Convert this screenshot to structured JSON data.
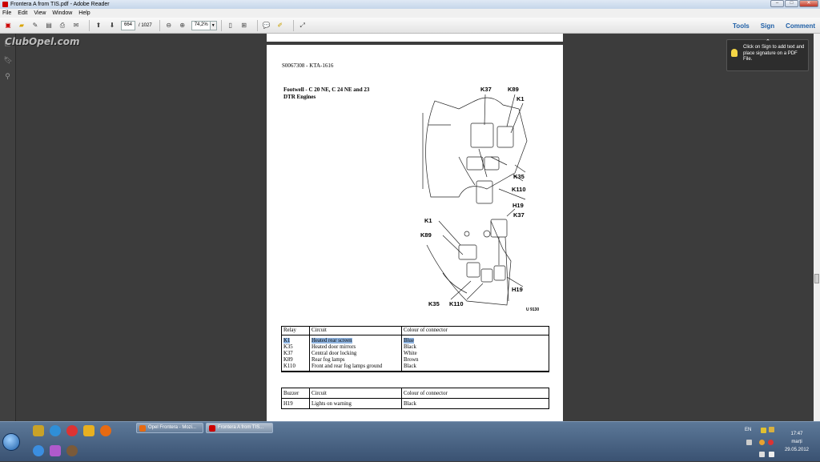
{
  "window": {
    "title": "Frontera A from TIS.pdf - Adobe Reader",
    "buttons": [
      "–",
      "□",
      "✕"
    ]
  },
  "menu": [
    "File",
    "Edit",
    "View",
    "Window",
    "Help"
  ],
  "toolbar": {
    "page_current": "664",
    "page_total": "/ 1027",
    "zoom": "74,2%",
    "right_links": [
      "Tools",
      "Sign",
      "Comment"
    ]
  },
  "watermark": "ClubOpel.com",
  "tooltip": {
    "text": "Click on Sign to add text and place signature on a PDF File."
  },
  "document": {
    "doc_id": "S0067308  -  KTA-1616",
    "heading": "Footwell - C 20 NE, C 24 NE and 23 DTR Engines",
    "diagram_labels": {
      "top": [
        "K37",
        "K89",
        "K1",
        "K35",
        "K110",
        "H19"
      ],
      "bottom": [
        "K1",
        "K89",
        "K37",
        "H19",
        "K35",
        "K110"
      ],
      "code": "U 9130"
    },
    "relay_table": {
      "headers": [
        "Relay",
        "Circuit",
        "Colour of connector"
      ],
      "rows": [
        [
          "K1",
          "Heated rear screen",
          "Blue"
        ],
        [
          "K35",
          "Heated door mirrors",
          "Black"
        ],
        [
          "K37",
          "Central door locking",
          "White"
        ],
        [
          "K89",
          "Rear fog lamps",
          "Brown"
        ],
        [
          "K110",
          "Front and rear fog lamps ground",
          "Black"
        ]
      ]
    },
    "buzzer_table": {
      "headers": [
        "Buzzer",
        "Circuit",
        "Colour of connector"
      ],
      "rows": [
        [
          "H19",
          "Lights on warning",
          "Black"
        ]
      ]
    }
  },
  "taskbar": {
    "tasks": [
      "Opel Frontera - Mozi...",
      "Frontera A from TIS..."
    ],
    "lang": "EN",
    "time": "17:47",
    "day": "marți",
    "date": "29.05.2012"
  }
}
